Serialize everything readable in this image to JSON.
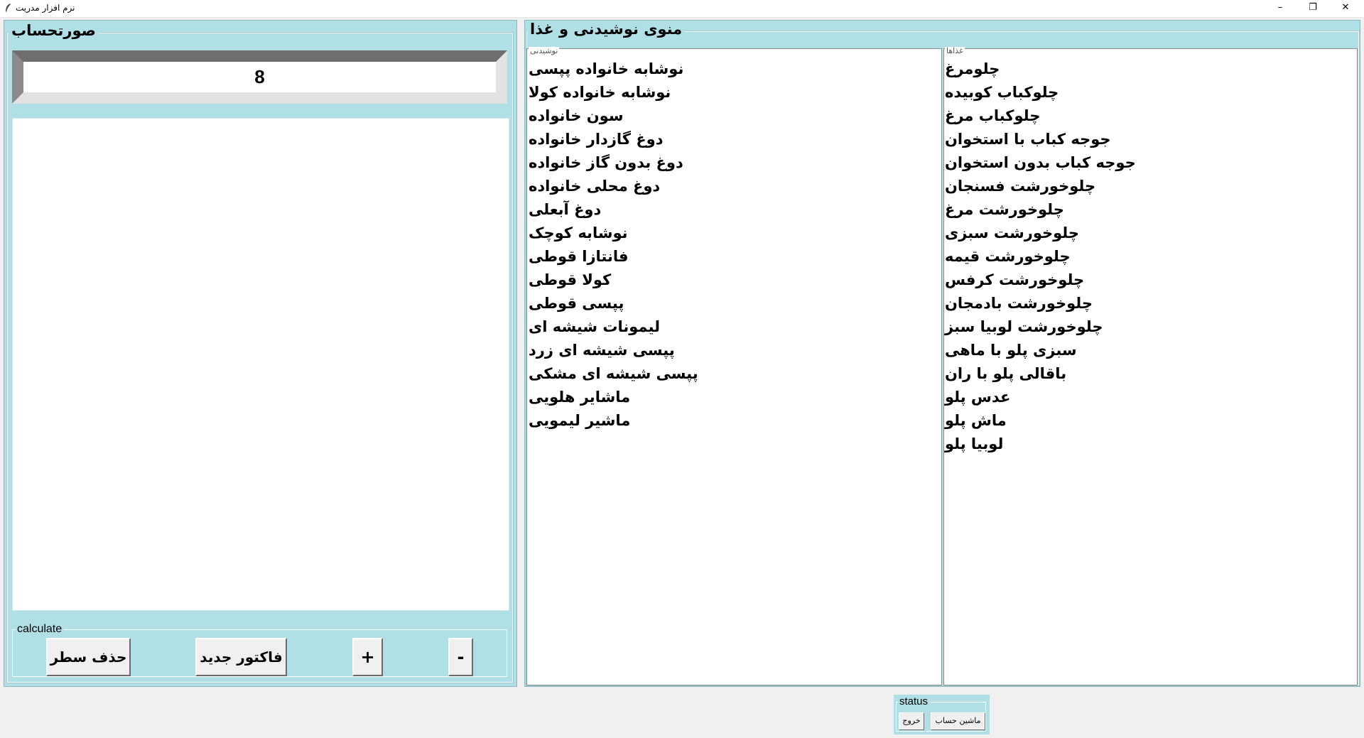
{
  "window": {
    "title": "نرم افزار مدریت",
    "icon": "feather-icon",
    "controls": {
      "minimize": "–",
      "maximize": "❐",
      "close": "✕"
    }
  },
  "invoice": {
    "caption": "صورتحساب",
    "display_value": "8",
    "calculate": {
      "caption": "calculate",
      "delete_row": "حذف سطر",
      "new_invoice": "فاکتور جدید",
      "plus": "+",
      "minus": "-"
    }
  },
  "menu": {
    "caption": "منوی نوشیدنی و غذا",
    "drinks": {
      "caption": "نوشیدنی",
      "items": [
        "نوشابه خانواده پپسی",
        "نوشابه خانواده کولا",
        "سون خانواده",
        "دوغ گازدار خانواده",
        "دوغ بدون گاز خانواده",
        "دوغ محلی خانواده",
        "دوغ آبعلی",
        "نوشابه کوچک",
        "فانتازا قوطی",
        "کولا قوطی",
        "پپسی قوطی",
        "لیمونات شیشه ای",
        "پپسی شیشه ای زرد",
        "پپسی شیشه ای مشکی",
        "ماشایر هلویی",
        "ماشیر لیمویی"
      ]
    },
    "foods": {
      "caption": "غذاها",
      "items": [
        "چلومرغ",
        "چلوکباب کوبیده",
        "چلوکباب مرغ",
        "جوجه کباب با استخوان",
        "جوجه کباب بدون استخوان",
        "چلوخورشت فسنجان",
        "چلوخورشت مرغ",
        "چلوخورشت سبزی",
        "چلوخورشت قیمه",
        "چلوخورشت کرفس",
        "چلوخورشت بادمجان",
        "چلوخورشت لوبیا سبز",
        "سبزی پلو با ماهی",
        "باقالی پلو با ران",
        "عدس پلو",
        "ماش پلو",
        "لوبیا پلو"
      ]
    }
  },
  "status": {
    "caption": "status",
    "calculator": "ماشین حساب",
    "exit": "خروج"
  },
  "colors": {
    "panel": "#b0e0e6",
    "background": "#f0f0f0"
  }
}
